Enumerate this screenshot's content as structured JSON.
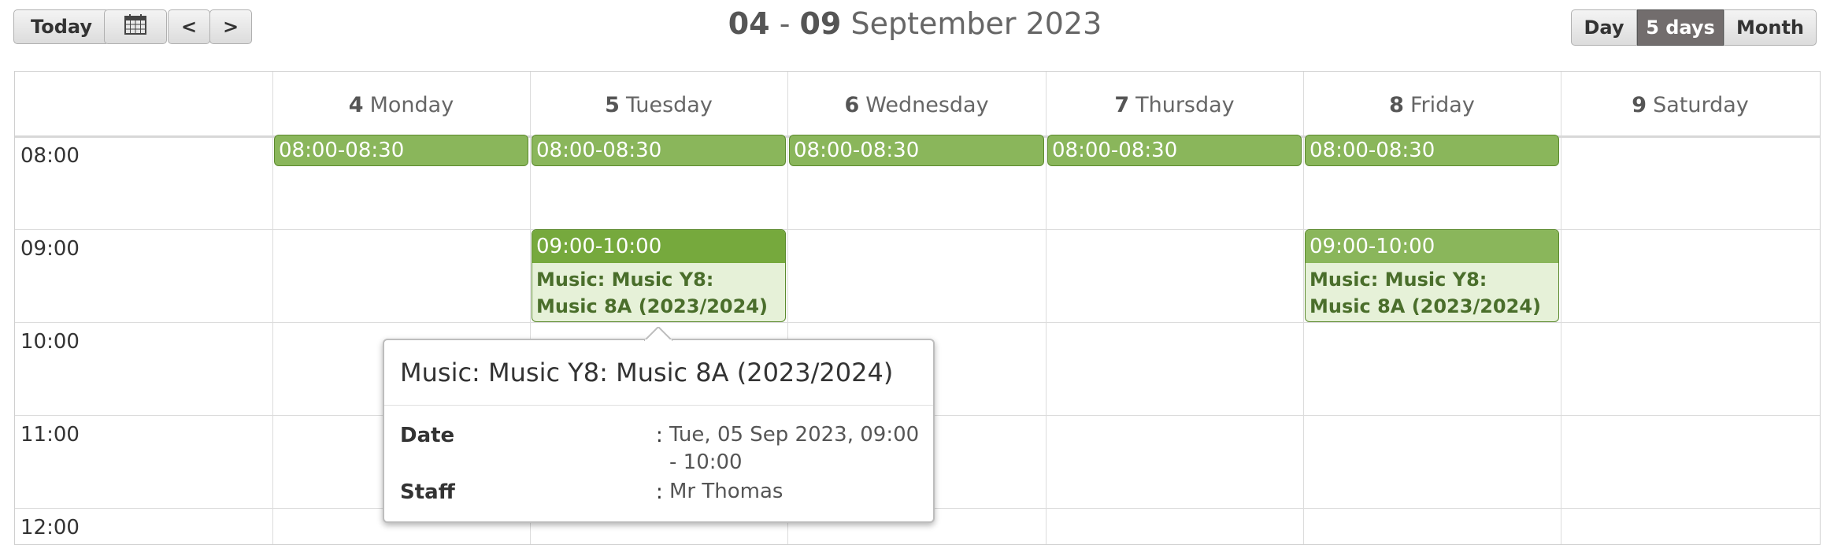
{
  "toolbar": {
    "today_label": "Today",
    "prev_label": "<",
    "next_label": ">",
    "calendar_icon": "calendar-icon"
  },
  "header": {
    "start_day": "04",
    "separator": " - ",
    "end_day": "09",
    "month_year": " September 2023"
  },
  "views": [
    {
      "label": "Day",
      "active": false
    },
    {
      "label": "5 days",
      "active": true
    },
    {
      "label": "Month",
      "active": false
    }
  ],
  "days": [
    {
      "num": "4",
      "name": "Monday"
    },
    {
      "num": "5",
      "name": "Tuesday"
    },
    {
      "num": "6",
      "name": "Wednesday"
    },
    {
      "num": "7",
      "name": "Thursday"
    },
    {
      "num": "8",
      "name": "Friday"
    },
    {
      "num": "9",
      "name": "Saturday"
    }
  ],
  "times": [
    "08:00",
    "09:00",
    "10:00",
    "11:00",
    "12:00"
  ],
  "events": {
    "short_time": "08:00-08:30",
    "long_time": "09:00-10:00",
    "long_title": "Music: Music Y8: Music 8A (2023/2024)"
  },
  "popup": {
    "title": "Music: Music Y8: Music 8A (2023/2024)",
    "date_label": "Date",
    "date_value": "Tue, 05 Sep 2023, 09:00 - 10:00",
    "staff_label": "Staff",
    "staff_value": "Mr Thomas",
    "colon": ":"
  },
  "colors": {
    "event_green": "#8ab65b",
    "event_border": "#5c8a2e",
    "event_body": "#e6f1d8",
    "active_view": "#726d6d"
  }
}
